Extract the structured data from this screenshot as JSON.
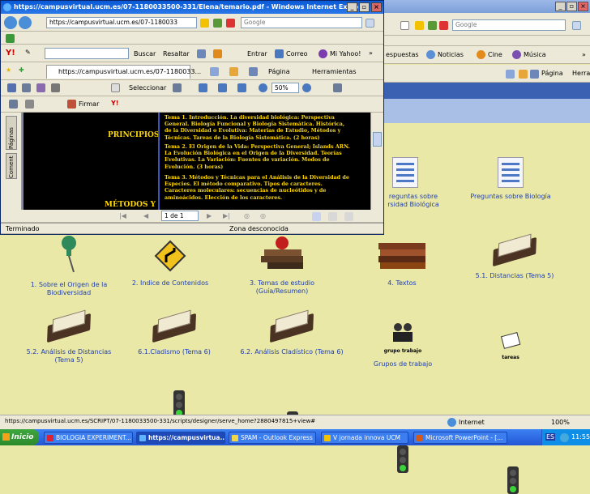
{
  "bg": {
    "search_placeholder": "Google",
    "links": [
      "espuestas",
      "Noticias",
      "Cine",
      "Música"
    ],
    "cmd": [
      "Página",
      "Herramientas"
    ]
  },
  "front": {
    "title": "https://campusvirtual.ucm.es/07-1180033500-331/Elena/temario.pdf - Windows Internet Explorer",
    "address": "https://campusvirtual.ucm.es/07-1180033",
    "search_placeholder": "Google",
    "yahoo": {
      "buscar": "Buscar",
      "resaltar": "Resaltar",
      "entrar": "Entrar",
      "correo": "Correo",
      "miyahoo": "Mi Yahoo!"
    },
    "tab_label": "https://campusvirtual.ucm.es/07-1180033...",
    "cmd": {
      "pagina": "Página",
      "herramientas": "Herramientas"
    },
    "pdf_tools": {
      "seleccionar": "Seleccionar",
      "zoom": "50%",
      "firmar": "Firmar"
    },
    "side_tabs": [
      "Páginas",
      "Coment"
    ],
    "pdf": {
      "heading1": "PRINCIPIOS",
      "heading2": "MÉTODOS Y",
      "tema1": "Tema 1. Introducción. La diversidad biológica: Perspectiva General. Biología Funcional y Biología Sistemática. Histórica, de la Diversidad o Evolutiva: Materias de Estudio, Métodos y Técnicas. Tareas de la Biología Sistemática. (2 horas)",
      "tema2": "Tema 2. El Origen de la Vida: Perspectiva General; Islands ARN. La Evolución Biológica en el Origen de la Diversidad. Teorías Evolutivas. La Variación: Fuentes de variación. Modos de Evolución. (3 horas)",
      "tema3": "Tema 3. Métodos y Técnicas para el Análisis de la Diversidad de Especies. El método comparativo. Tipos de caracteres. Caracteres moleculares: secuencias de nucleótidos y de aminoácidos. Elección de los caracteres."
    },
    "page_nav": "1 de 1",
    "status_left": "Terminado",
    "status_zone": "Zona desconocida"
  },
  "content": {
    "top_right_items": [
      "Preguntas sobre Diversidad Biológica",
      "Preguntas sobre Biología"
    ],
    "top_right_partial": [
      "reguntas sobre",
      "rsidad Biológica"
    ],
    "row1": [
      "1. Sobre el Origen de la Biodiversidad",
      "2. Indice de Contenidos",
      "3. Temas de estudio (Guía/Resumen)",
      "4. Textos",
      "5.1. Distancias (Tema 5)"
    ],
    "row2": [
      "5.2. Análisis de Distancias (Tema 5)",
      "6.1.Cladismo (Tema 6)",
      "6.2. Análisis Cladístico (Tema 6)",
      "Grupos de trabajo"
    ],
    "grupo_caption": "grupo trabajo",
    "tareas_caption": "tareas"
  },
  "status": {
    "url": "https://campusvirtual.ucm.es/SCRIPT/07-1180033500-331/scripts/designer/serve_home?2880497815+view#",
    "zone": "Internet",
    "zoom": "100%"
  },
  "taskbar": {
    "start": "Inicio",
    "buttons": [
      "BIOLOGIA EXPERIMENT...",
      "https://campusvirtua...",
      "SPAM - Outlook Express",
      "V jornada innova UCM",
      "Microsoft PowerPoint - [..."
    ],
    "clock": "11:55",
    "lang": "ES"
  }
}
